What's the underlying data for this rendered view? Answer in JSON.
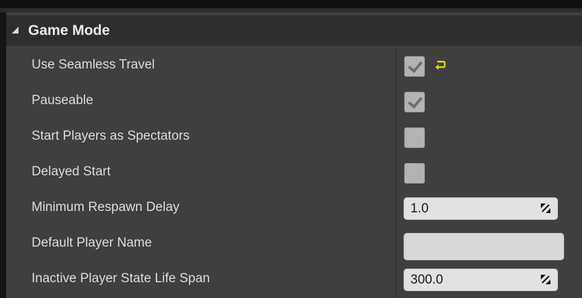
{
  "category": {
    "title": "Game Mode",
    "expanded": true
  },
  "properties": [
    {
      "label": "Use Seamless Travel",
      "type": "checkbox",
      "checked": true,
      "modified_from_default": true
    },
    {
      "label": "Pauseable",
      "type": "checkbox",
      "checked": true
    },
    {
      "label": "Start Players as Spectators",
      "type": "checkbox",
      "checked": false
    },
    {
      "label": "Delayed Start",
      "type": "checkbox",
      "checked": false
    },
    {
      "label": "Minimum Respawn Delay",
      "type": "number",
      "value": "1.0"
    },
    {
      "label": "Default Player Name",
      "type": "text",
      "value": ""
    },
    {
      "label": "Inactive Player State Life Span",
      "type": "number",
      "value": "300.0"
    }
  ],
  "icons": {
    "collapse": "collapse-arrow-icon",
    "reset": "reset-to-default-icon",
    "spin": "numeric-drag-icon"
  },
  "colors": {
    "panel_bg": "#3f3f3f",
    "header_bg": "#2e2e2e",
    "reset_arrow": "#e8d500",
    "field_bg": "#e2e2e2"
  }
}
